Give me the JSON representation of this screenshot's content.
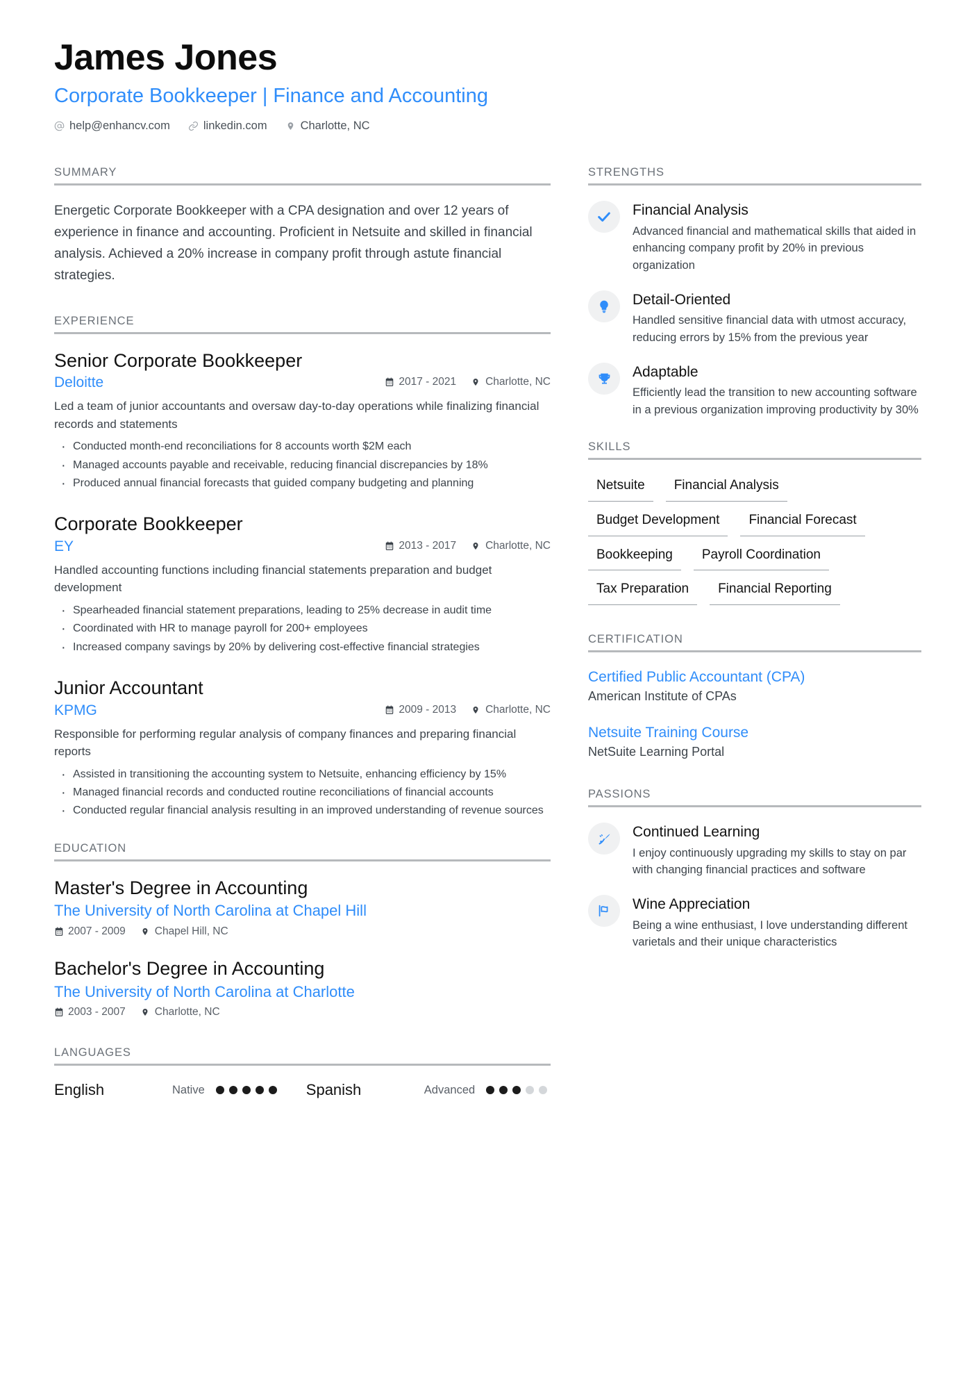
{
  "header": {
    "name": "James Jones",
    "headline": "Corporate Bookkeeper | Finance and Accounting",
    "contacts": [
      {
        "icon": "at-icon",
        "text": "help@enhancv.com"
      },
      {
        "icon": "link-icon",
        "text": "linkedin.com"
      },
      {
        "icon": "location-pin-icon",
        "text": "Charlotte, NC"
      }
    ]
  },
  "summary": {
    "title": "SUMMARY",
    "text": "Energetic Corporate Bookkeeper with a CPA designation and over 12 years of experience in finance and accounting. Proficient in Netsuite and skilled in financial analysis. Achieved a 20% increase in company profit through astute financial strategies."
  },
  "experience": {
    "title": "EXPERIENCE",
    "jobs": [
      {
        "role": "Senior Corporate Bookkeeper",
        "company": "Deloitte",
        "dates": "2017 - 2021",
        "location": "Charlotte, NC",
        "description": "Led a team of junior accountants and oversaw day-to-day operations while finalizing financial records and statements",
        "bullets": [
          "Conducted month-end reconciliations for 8 accounts worth $2M each",
          "Managed accounts payable and receivable, reducing financial discrepancies by 18%",
          "Produced annual financial forecasts that guided company budgeting and planning"
        ]
      },
      {
        "role": "Corporate Bookkeeper",
        "company": "EY",
        "dates": "2013 - 2017",
        "location": "Charlotte, NC",
        "description": "Handled accounting functions including financial statements preparation and budget development",
        "bullets": [
          "Spearheaded financial statement preparations, leading to 25% decrease in audit time",
          "Coordinated with HR to manage payroll for 200+ employees",
          "Increased company savings by 20% by delivering cost-effective financial strategies"
        ]
      },
      {
        "role": "Junior Accountant",
        "company": "KPMG",
        "dates": "2009 - 2013",
        "location": "Charlotte, NC",
        "description": "Responsible for performing regular analysis of company finances and preparing financial reports",
        "bullets": [
          "Assisted in transitioning the accounting system to Netsuite, enhancing efficiency by 15%",
          "Managed financial records and conducted routine reconciliations of financial accounts",
          "Conducted regular financial analysis resulting in an improved understanding of revenue sources"
        ]
      }
    ]
  },
  "education": {
    "title": "EDUCATION",
    "entries": [
      {
        "degree": "Master's Degree in Accounting",
        "school": "The University of North Carolina at Chapel Hill",
        "dates": "2007 - 2009",
        "location": "Chapel Hill, NC"
      },
      {
        "degree": "Bachelor's Degree in Accounting",
        "school": "The University of North Carolina at Charlotte",
        "dates": "2003 - 2007",
        "location": "Charlotte, NC"
      }
    ]
  },
  "languages": {
    "title": "LANGUAGES",
    "items": [
      {
        "name": "English",
        "level": "Native",
        "filled": 5,
        "total": 5
      },
      {
        "name": "Spanish",
        "level": "Advanced",
        "filled": 3,
        "total": 5
      }
    ]
  },
  "strengths": {
    "title": "STRENGTHS",
    "items": [
      {
        "icon": "check-icon",
        "title": "Financial Analysis",
        "desc": "Advanced financial and mathematical skills that aided in enhancing company profit by 20% in previous organization"
      },
      {
        "icon": "lightbulb-icon",
        "title": "Detail-Oriented",
        "desc": "Handled sensitive financial data with utmost accuracy, reducing errors by 15% from the previous year"
      },
      {
        "icon": "trophy-icon",
        "title": "Adaptable",
        "desc": "Efficiently lead the transition to new accounting software in a previous organization improving productivity by 30%"
      }
    ]
  },
  "skills": {
    "title": "SKILLS",
    "items": [
      "Netsuite",
      "Financial Analysis",
      "Budget Development",
      "Financial Forecast",
      "Bookkeeping",
      "Payroll Coordination",
      "Tax Preparation",
      "Financial Reporting"
    ]
  },
  "certification": {
    "title": "CERTIFICATION",
    "items": [
      {
        "name": "Certified Public Accountant (CPA)",
        "issuer": "American Institute of CPAs"
      },
      {
        "name": "Netsuite Training Course",
        "issuer": "NetSuite Learning Portal"
      }
    ]
  },
  "passions": {
    "title": "PASSIONS",
    "items": [
      {
        "icon": "rocket-icon",
        "title": "Continued Learning",
        "desc": "I enjoy continuously upgrading my skills to stay on par with changing financial practices and software"
      },
      {
        "icon": "flag-icon",
        "title": "Wine Appreciation",
        "desc": "Being a wine enthusiast, I love understanding different varietals and their unique characteristics"
      }
    ]
  },
  "colors": {
    "accent": "#2f8dfa",
    "text": "#3d444b",
    "heading": "#6b7178",
    "rule": "#b6b9bc"
  }
}
